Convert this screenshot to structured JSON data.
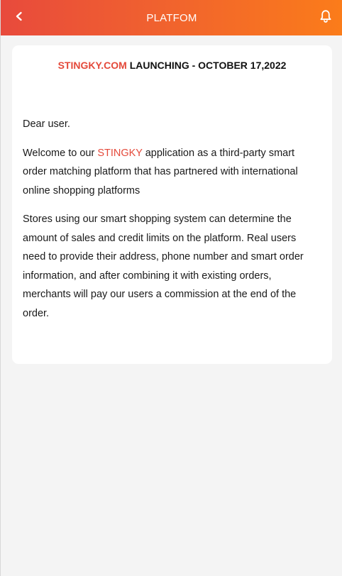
{
  "header": {
    "title": "PLATFOM",
    "back_icon": "chevron-left-icon",
    "bell_icon": "bell-icon",
    "background_start": "#e84a3c",
    "background_end": "#fb7c1a"
  },
  "notice": {
    "title_brand": "STINGKY.COM",
    "title_rest": " LAUNCHING - OCTOBER 17,2022",
    "greeting": "Dear user.",
    "para1_prefix": "Welcome to our ",
    "para1_brand": "STINGKY",
    "para1_suffix": " application as a third-party smart order matching platform that has partnered with international online shopping platforms",
    "para2": "Stores using our smart shopping system can determine the amount of sales and credit limits on the platform. Real users need to provide their address, phone number and smart order information, and after combining it with existing orders, merchants will pay our users a commission at the end of the order.",
    "brand_color": "#e4493a"
  }
}
